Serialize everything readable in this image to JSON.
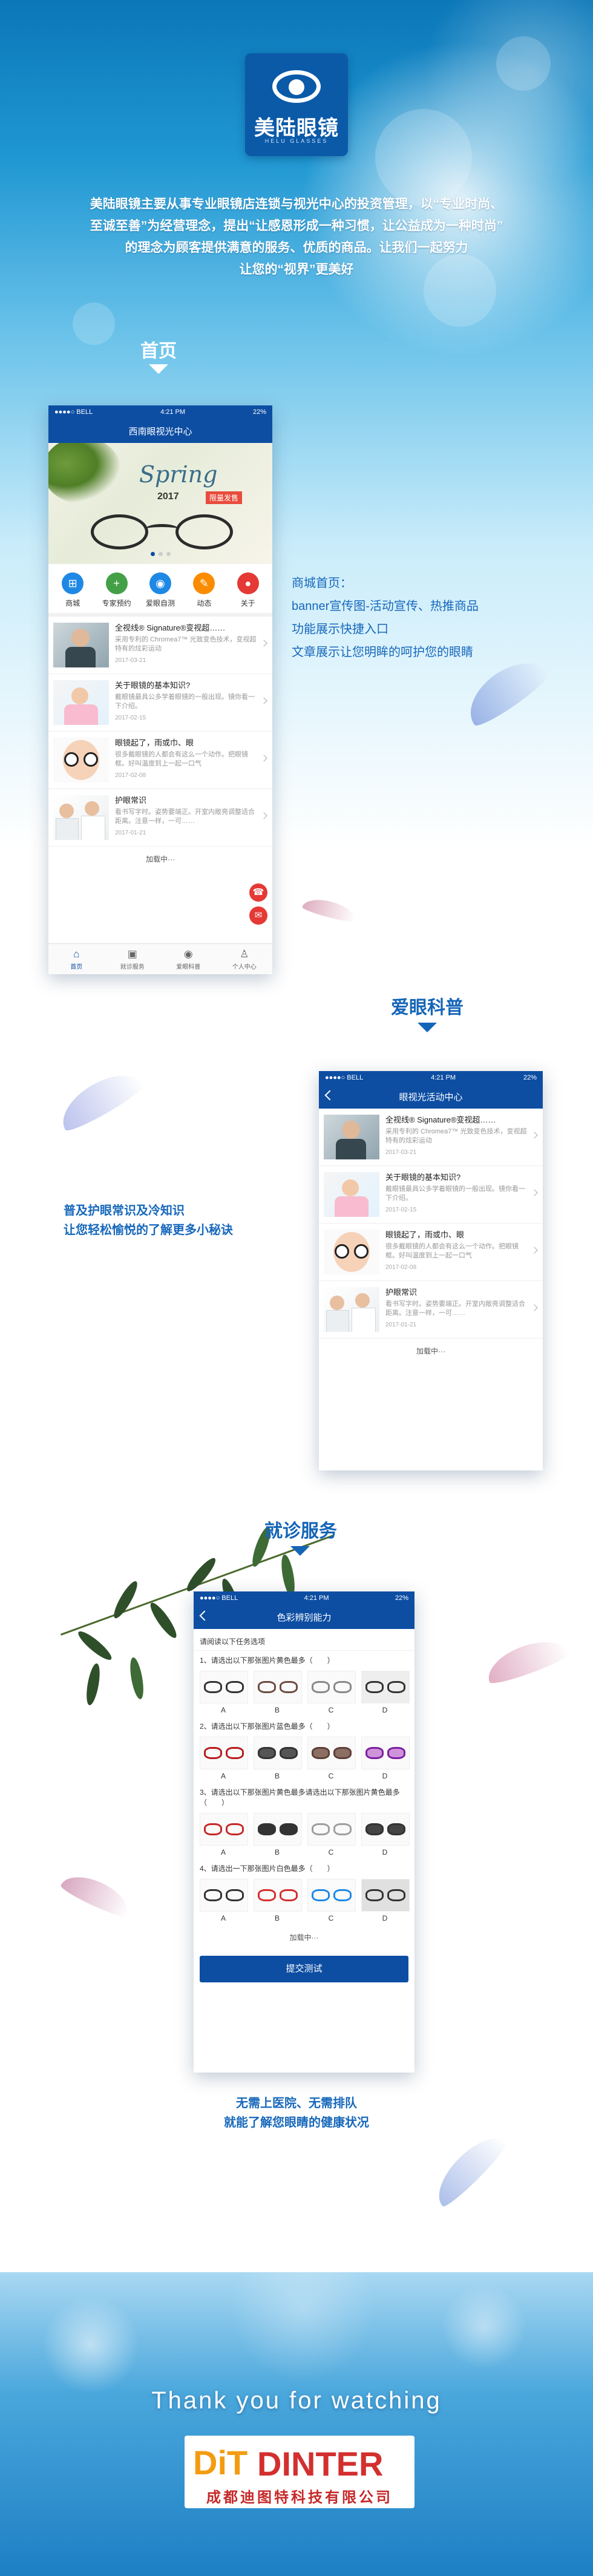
{
  "brand": {
    "logo_name": "美陆眼镜",
    "logo_sub": "HELU GLASSES"
  },
  "intro": {
    "lines": [
      "美陆眼镜主要从事专业眼镜店连锁与视光中心的投资管理，以“专业时尚、",
      "至诚至善”为经营理念，提出“让感恩形成一种习惯，让公益成为一种时尚”",
      "的理念为顾客提供满意的服务、优质的商品。让我们一起努力",
      "让您的“视界”更美好"
    ]
  },
  "sections": {
    "home": {
      "title": "首页",
      "desc": [
        "商城首页：",
        "banner宣传图-活动宣传、热推商品",
        "功能展示快捷入口",
        "文章展示让您明眸的呵护您的眼睛"
      ]
    },
    "science": {
      "title": "爱眼科普",
      "desc": [
        "普及护眼常识及冷知识",
        "让您轻松愉悦的了解更多小秘诀"
      ]
    },
    "service": {
      "title": "就诊服务",
      "desc": [
        "无需上医院、无需排队",
        "就能了解您眼睛的健康状况"
      ]
    }
  },
  "status": {
    "carrier": "●●●●○ BELL",
    "time": "4:21 PM",
    "battery": "22%"
  },
  "phone1": {
    "nav_title": "西南眼视光中心",
    "banner": {
      "script": "Spring",
      "year": "2017",
      "tag": "限量发售"
    },
    "quick": [
      {
        "label": "商城",
        "icon": "shop-icon",
        "glyph": "⊞",
        "color": "#1e88e5"
      },
      {
        "label": "专家预约",
        "icon": "plus-icon",
        "glyph": "+",
        "color": "#43a047"
      },
      {
        "label": "爱眼自测",
        "icon": "eye-icon",
        "glyph": "◉",
        "color": "#1e88e5"
      },
      {
        "label": "动态",
        "icon": "megaphone-icon",
        "glyph": "✎",
        "color": "#fb8c00"
      },
      {
        "label": "关于",
        "icon": "info-icon",
        "glyph": "●",
        "color": "#e53935"
      }
    ],
    "articles": [
      {
        "title": "全视线® Signature®变视超……",
        "summary": "采用专利的 Chromea7™ 光致变色技术，变视超特有的炫彩运动",
        "date": "2017-03-21"
      },
      {
        "title": "关于眼镜的基本知识?",
        "summary": "戴眼镜最具公多学着眼镜的一般出现。镜你看一下介绍。",
        "date": "2017-02-15"
      },
      {
        "title": "眼镜起了，雨或巾、眼",
        "summary": "很多戴眼镜的人都会有这么一个动作。把眼镜框。好叫温度到上一起一口气",
        "date": "2017-02-08"
      },
      {
        "title": "护眼常识",
        "summary": "看书写字时。姿势要端正。开室内敞亮调整适合距离。注意一样，一可……",
        "date": "2017-01-21"
      }
    ],
    "loading": "加载中···",
    "tabs": [
      {
        "label": "首页",
        "icon": "home-icon",
        "glyph": "⌂"
      },
      {
        "label": "就诊服务",
        "icon": "clipboard-icon",
        "glyph": "▣"
      },
      {
        "label": "爱眼科普",
        "icon": "eye-icon",
        "glyph": "◉"
      },
      {
        "label": "个人中心",
        "icon": "user-icon",
        "glyph": "♙"
      }
    ]
  },
  "phone2": {
    "nav_title": "眼视光活动中心",
    "articles": [
      {
        "title": "全视线® Signature®变视超……",
        "summary": "采用专利的 Chromea7™ 光致变色技术，变视超特有的炫彩运动",
        "date": "2017-03-21"
      },
      {
        "title": "关于眼镜的基本知识?",
        "summary": "戴眼镜最具公多学着眼镜的一般出现。镜你看一下介绍。",
        "date": "2017-02-15"
      },
      {
        "title": "眼镜起了，雨或巾、眼",
        "summary": "很多戴眼镜的人都会有这么一个动作。把眼镜框。好叫温度到上一起一口气",
        "date": "2017-02-08"
      },
      {
        "title": "护眼常识",
        "summary": "看书写字时。姿势要端正。开室内敞亮调整适合距离。注意一样，一可……",
        "date": "2017-01-21"
      }
    ],
    "loading": "加载中···"
  },
  "phone3": {
    "nav_title": "色彩辨别能力",
    "intro": "请阅读以下任务选项",
    "questions": [
      {
        "text": "1、请选出以下那张图片黄色最多（　　）",
        "options": [
          "A",
          "B",
          "C",
          "D"
        ]
      },
      {
        "text": "2、请选出以下那张图片蓝色最多（　　）",
        "options": [
          "A",
          "B",
          "C",
          "D"
        ]
      },
      {
        "text": "3、请选出以下那张图片黄色最多请选出以下那张图片黄色最多（　　）",
        "options": [
          "A",
          "B",
          "C",
          "D"
        ]
      },
      {
        "text": "4、请选出一下那张图片白色最多（　　）",
        "options": [
          "A",
          "B",
          "C",
          "D"
        ]
      }
    ],
    "loading": "加载中···",
    "submit": "提交测试"
  },
  "footer": {
    "thanks": "Thank you for watching",
    "brand_mark": "DiT",
    "brand_name": "DINTER",
    "company": "成都迪图特科技有限公司"
  }
}
